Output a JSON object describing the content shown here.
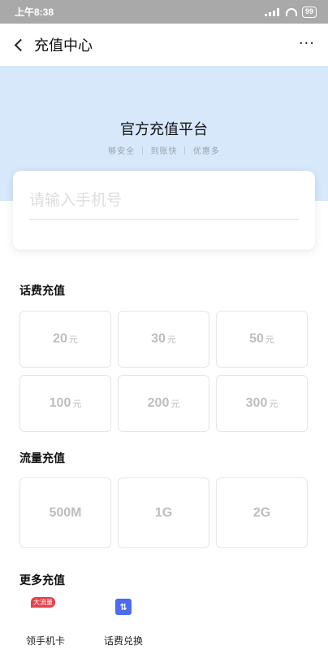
{
  "status_bar": {
    "time": "上午8:38",
    "battery": "99"
  },
  "nav": {
    "title": "充值中心",
    "more": "···"
  },
  "hero": {
    "title": "官方充值平台",
    "subtitle": "够安全 ｜ 到账快 ｜ 优惠多"
  },
  "phone_input": {
    "placeholder": "请输入手机号",
    "value": ""
  },
  "sections": {
    "topup": {
      "title": "话费充值",
      "options": [
        {
          "amount": "20",
          "unit": "元"
        },
        {
          "amount": "30",
          "unit": "元"
        },
        {
          "amount": "50",
          "unit": "元"
        },
        {
          "amount": "100",
          "unit": "元"
        },
        {
          "amount": "200",
          "unit": "元"
        },
        {
          "amount": "300",
          "unit": "元"
        }
      ]
    },
    "data": {
      "title": "流量充值",
      "options": [
        {
          "label": "500M"
        },
        {
          "label": "1G"
        },
        {
          "label": "2G"
        }
      ]
    },
    "more": {
      "title": "更多充值",
      "items": [
        {
          "label": "领手机卡",
          "badge": "大流量"
        },
        {
          "label": "话费兑换",
          "icon_glyph": "⇅"
        }
      ]
    }
  },
  "colors": {
    "hero_bg": "#d7e8fb",
    "badge": "#e5424a",
    "exchange_icon": "#4a6cf0",
    "status_bar": "#a9a9a9"
  },
  "icons": [
    "back-chevron-icon",
    "more-dots-icon",
    "signal-icon",
    "wifi-icon",
    "battery-icon",
    "sim-card-icon",
    "exchange-icon"
  ]
}
